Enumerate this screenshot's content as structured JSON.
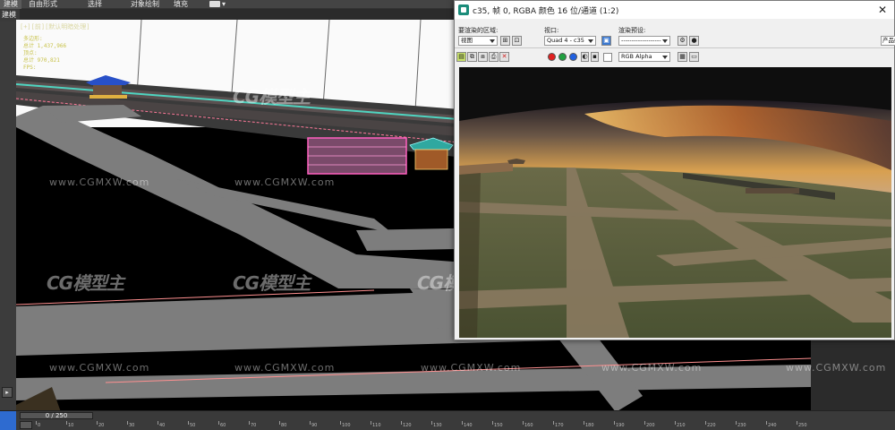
{
  "ribbon": {
    "tabs": [
      "建模",
      "自由形式",
      "选择",
      "对象绘制",
      "填充"
    ]
  },
  "mode_strip": "建模",
  "viewport": {
    "label": "[+][前][默认明暗处理]",
    "stats": [
      "多边形:",
      "总计 1,437,966",
      "顶点:",
      "总计 970,821",
      "FPS:"
    ]
  },
  "watermarks": {
    "logo": "CG模型主",
    "url": "www.CGMXW.com"
  },
  "render_window": {
    "title": "c35, 帧 0, RGBA 颜色 16 位/通道 (1:2)",
    "close_label": "✕",
    "area_label": "要渲染的区域:",
    "area_value": "视图",
    "viewport_label": "视口:",
    "viewport_value": "Quad 4 - c35",
    "preset_label": "渲染预设:",
    "preset_value": "-------------------",
    "product_button": "产品级",
    "channel_value": "RGB Alpha"
  },
  "timeline": {
    "slider": "0 / 250",
    "ruler": [
      0,
      10,
      20,
      30,
      40,
      50,
      60,
      70,
      80,
      90,
      100,
      110,
      120,
      130,
      140,
      150,
      160,
      170,
      180,
      190,
      200,
      210,
      220,
      230,
      240,
      250
    ]
  },
  "colors": {
    "render_red": "#e02020",
    "render_green": "#20a040",
    "render_blue": "#2060e0"
  }
}
